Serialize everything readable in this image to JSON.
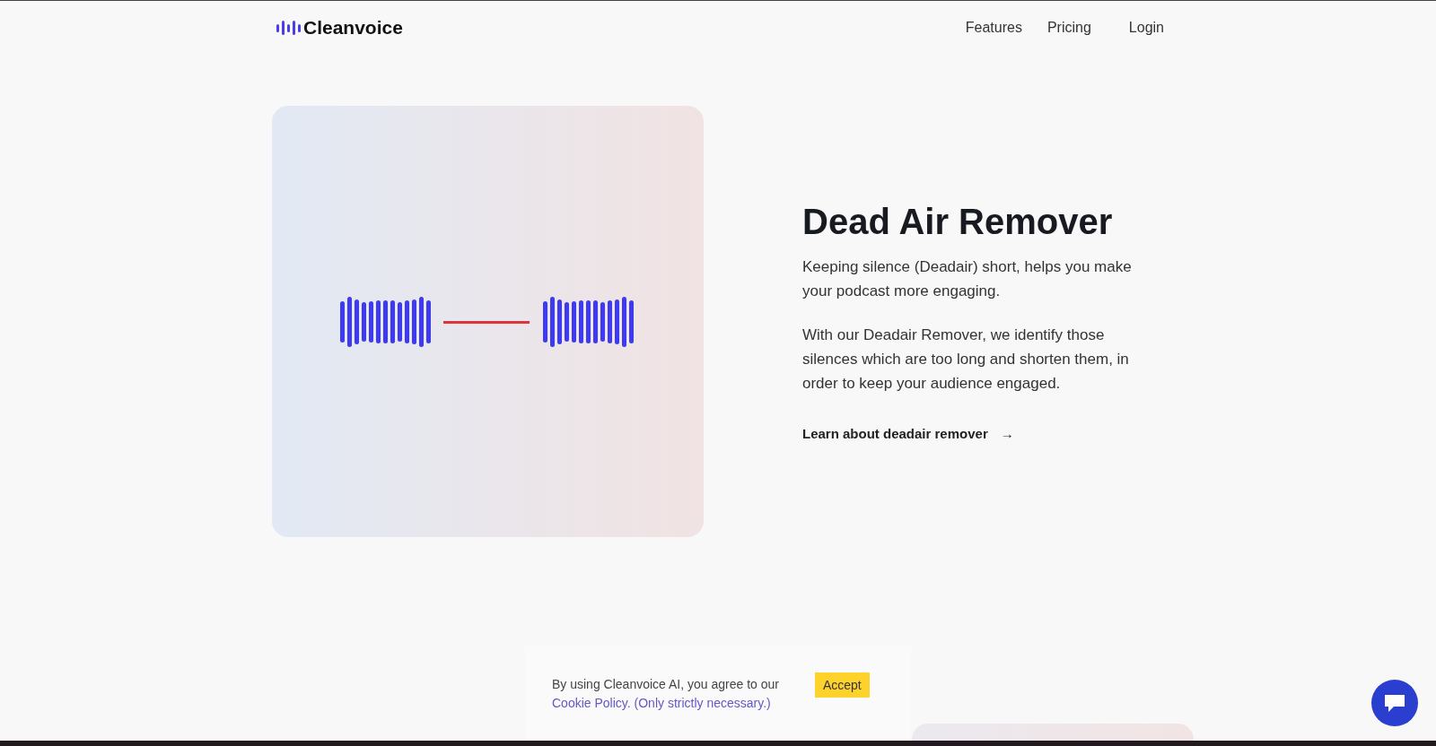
{
  "header": {
    "logo": "Cleanvoice",
    "nav": [
      "Features",
      "Pricing",
      "Login"
    ]
  },
  "feature": {
    "title": "Dead Air Remover",
    "paragraphs": [
      "Keeping silence (Deadair) short, helps you make your podcast more engaging.",
      "With our Deadair Remover, we identify those silences which are too long and shorten them, in order to keep your audience engaged."
    ],
    "link": "Learn about deadair remover",
    "link_arrow": "→"
  },
  "cookie_banner": {
    "text": "By using Cleanvoice AI, you agree to our",
    "link": "Cookie Policy. (Only strictly necessary.)",
    "button": "Accept"
  }
}
